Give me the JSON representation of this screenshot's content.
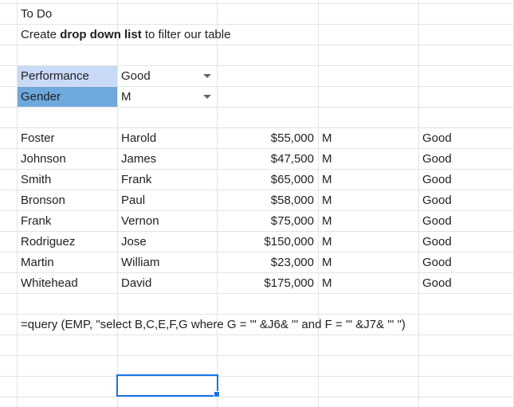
{
  "notes": {
    "line1": "To Do",
    "line2_pre": "Create ",
    "line2_bold": "drop down list",
    "line2_post": " to filter our table"
  },
  "filters": [
    {
      "label": "Performance",
      "value": "Good",
      "label_color": "#c9daf8"
    },
    {
      "label": "Gender",
      "value": "M",
      "label_color": "#6fa8dc"
    }
  ],
  "rows": [
    {
      "last": "Foster",
      "first": "Harold",
      "salary": "$55,000",
      "gender": "M",
      "rating": "Good"
    },
    {
      "last": "Johnson",
      "first": "James",
      "salary": "$47,500",
      "gender": "M",
      "rating": "Good"
    },
    {
      "last": "Smith",
      "first": "Frank",
      "salary": "$65,000",
      "gender": "M",
      "rating": "Good"
    },
    {
      "last": "Bronson",
      "first": "Paul",
      "salary": "$58,000",
      "gender": "M",
      "rating": "Good"
    },
    {
      "last": "Frank",
      "first": "Vernon",
      "salary": "$75,000",
      "gender": "M",
      "rating": "Good"
    },
    {
      "last": "Rodriguez",
      "first": "Jose",
      "salary": "$150,000",
      "gender": "M",
      "rating": "Good"
    },
    {
      "last": "Martin",
      "first": "William",
      "salary": "$23,000",
      "gender": "M",
      "rating": "Good"
    },
    {
      "last": "Whitehead",
      "first": "David",
      "salary": "$175,000",
      "gender": "M",
      "rating": "Good"
    }
  ],
  "formula": "=query (EMP, \"select B,C,E,F,G where G = '\" &J6& \"' and F = '\" &J7& \"' \")",
  "icons": {
    "dropdown": "chevron-down-icon"
  },
  "colors": {
    "selection": "#1a73e8",
    "gridline": "#e2e3e3"
  }
}
